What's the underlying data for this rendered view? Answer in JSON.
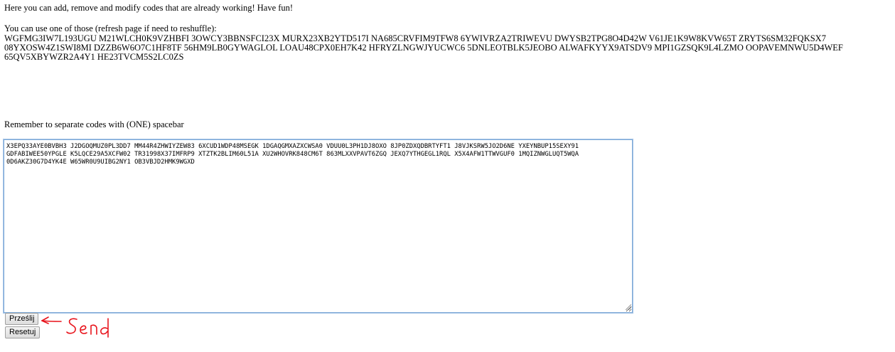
{
  "intro": "Here you can add, remove and modify codes that are already working! Have fun!",
  "use_one": "You can use one of those (refresh page if need to reshuffle):",
  "available_codes": "WGFMG3IW7L193UGU M21WLCH0K9VZHBFI 3OWCY3BBNSFCI23X MURX23XB2YTD517I NA685CRVFIM9TFW8 6YWIVRZA2TRIWEVU DWYSB2TPG8O4D42W V61JE1K9W8KVW65T ZRYTS6SM32FQKSX7 08YXOSW4Z1SWI8MI DZZB6W6O7C1HF8TF 56HM9LB0GYWAGLOL LOAU48CPX0EH7K42 HFRYZLNGWJYUCWC6 5DNLEOTBLK5JEOBO ALWAFKYYX9ATSDV9 MPI1GZSQK9L4LZMO OOPAVEMNWU5D4WEF 65QV5XBYWZR2A4Y1 HE23TVCM5S2LC0ZS",
  "reminder": "Remember to separate codes with (ONE) spacebar",
  "textarea_value": "X3EPQ33AYE0BVBH3 J2DGOQMUZ0PL3DD7 MM44R4ZHWIYZEW83 6XCUD1WDP48MSEGK 1DGAQGMXAZXCWSA0 VDUU0L3PH1DJ8OXO 8JP0ZDXQDBRTYFT1 J8VJKSRW5JO2D6NE YXEYNBUP15SEXY91 GDFABIWEE50YPGLE K5LQCE29A5XCFW02 TR31998X37IMFRP9 XTZTK2BLIM60L51A XU2WHOVRK848CM6T 863MLXXVPAVT6ZGQ JEXQ7YTHGEGL1RQL X5X4AFW1TTWVGUF0 1MQIZNWGLUQT5WQA 0D6AKZ30G7D4YK4E W65WR0U9UIBG2NY1 OB3VBJD2HMK9WGXD",
  "buttons": {
    "submit": "Prześlij",
    "reset": "Resetuj"
  },
  "annotation": {
    "text": "Send",
    "color": "#e8141c"
  }
}
